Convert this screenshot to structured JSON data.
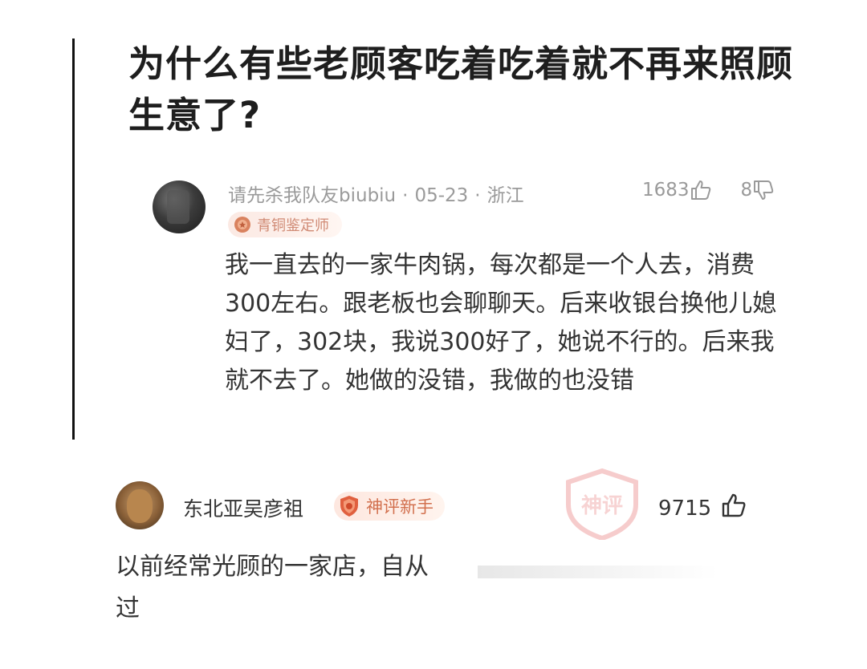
{
  "question": {
    "title": "为什么有些老顾客吃着吃着就不再来照顾生意了?"
  },
  "answer": {
    "username": "请先杀我队友biubiu",
    "date": "05-23",
    "location": "浙江",
    "likes": "1683",
    "dislikes": "8",
    "badge": "青铜鉴定师",
    "text": "我一直去的一家牛肉锅，每次都是一个人去，消费300左右。跟老板也会聊聊天。后来收银台换他儿媳妇了，302块，我说300好了，她说不行的。后来我就不去了。她做的没错，我做的也没错"
  },
  "reply": {
    "username": "东北亚吴彦祖",
    "badge": "神评新手",
    "likes": "9715",
    "text_line1": "以前经常光顾的一家店，自从",
    "text_line2": "过",
    "watermark": "神评"
  },
  "colors": {
    "meta_gray": "#9a9a9a",
    "badge_bronze": "#d08a74",
    "badge_red": "#d2704e",
    "text": "#333333"
  },
  "icons": {
    "like": "thumbs-up-icon",
    "dislike": "thumbs-down-icon",
    "badge1": "bronze-medal-icon",
    "badge2": "shield-badge-icon"
  }
}
